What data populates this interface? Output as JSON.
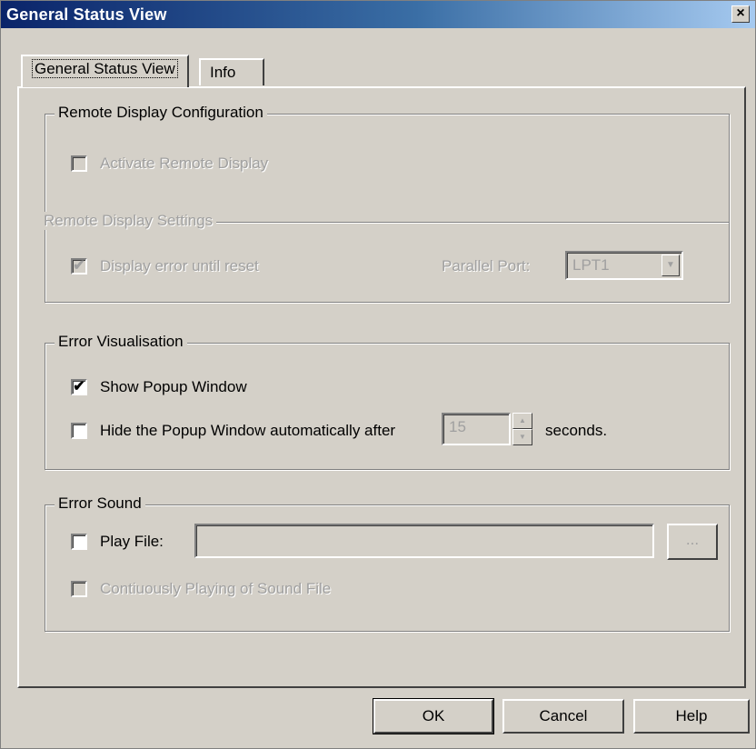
{
  "window": {
    "title": "General Status View",
    "close_glyph": "×"
  },
  "tabs": [
    {
      "label": "General Status View",
      "active": true
    },
    {
      "label": "Info",
      "active": false
    }
  ],
  "remote_display": {
    "legend": "Remote Display Configuration",
    "activate_label": "Activate Remote Display",
    "activate_checked": false,
    "settings_legend": "Remote Display Settings",
    "display_error_label": "Display error until reset",
    "display_error_checked": true,
    "parallel_port_label": "Parallel Port:",
    "parallel_port_value": "LPT1"
  },
  "error_visualisation": {
    "legend": "Error Visualisation",
    "show_popup_label": "Show Popup Window",
    "show_popup_checked": true,
    "hide_popup_label": "Hide the Popup Window automatically after",
    "hide_popup_checked": false,
    "seconds_value": "15",
    "seconds_label": "seconds."
  },
  "error_sound": {
    "legend": "Error Sound",
    "play_file_label": "Play File:",
    "play_file_checked": false,
    "play_file_value": "",
    "browse_label": "...",
    "continuous_label": "Contiuously Playing of Sound File",
    "continuous_checked": false
  },
  "buttons": {
    "ok": "OK",
    "cancel": "Cancel",
    "help": "Help"
  },
  "icons": {
    "check": "✔",
    "dropdown": "▼",
    "spin_up": "▲",
    "spin_down": "▼"
  },
  "colors": {
    "title_start": "#0a246a",
    "title_end": "#a6caf0",
    "face": "#d4d0c8",
    "disabled_text": "#a0a0a0"
  }
}
